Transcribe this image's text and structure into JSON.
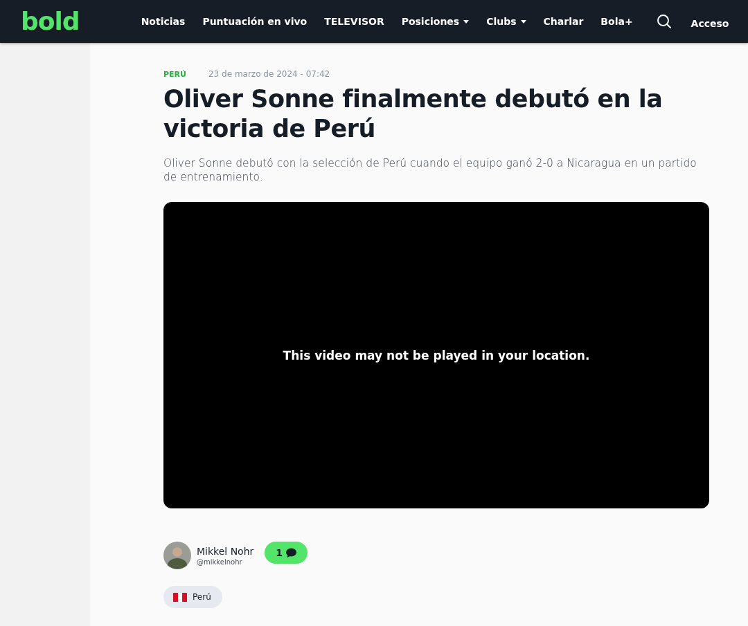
{
  "header": {
    "logo": "bold",
    "nav": [
      {
        "label": "Noticias",
        "dropdown": false
      },
      {
        "label": "Puntuación en vivo",
        "dropdown": false
      },
      {
        "label": "TELEVISOR",
        "dropdown": false
      },
      {
        "label": "Posiciones",
        "dropdown": true
      },
      {
        "label": "Clubs",
        "dropdown": true
      },
      {
        "label": "Charlar",
        "dropdown": false
      },
      {
        "label": "Bola+",
        "dropdown": false
      }
    ],
    "login": "Acceso"
  },
  "article": {
    "category": "PERÚ",
    "date": "23 de marzo de 2024 - 07:42",
    "title": "Oliver Sonne finalmente debutó en la victoria de Perú",
    "summary": "Oliver Sonne debutó con la selección de Perú cuando el equipo ganó 2-0 a Nicaragua en un partido de entrenamiento.",
    "video": {
      "message": "This video may not be played in your location."
    },
    "author": {
      "name": "Mikkel Nohr",
      "handle": "@mikkelnohr"
    },
    "comments": "1",
    "tags": [
      {
        "label": "Perú",
        "kind": "flag"
      }
    ]
  }
}
